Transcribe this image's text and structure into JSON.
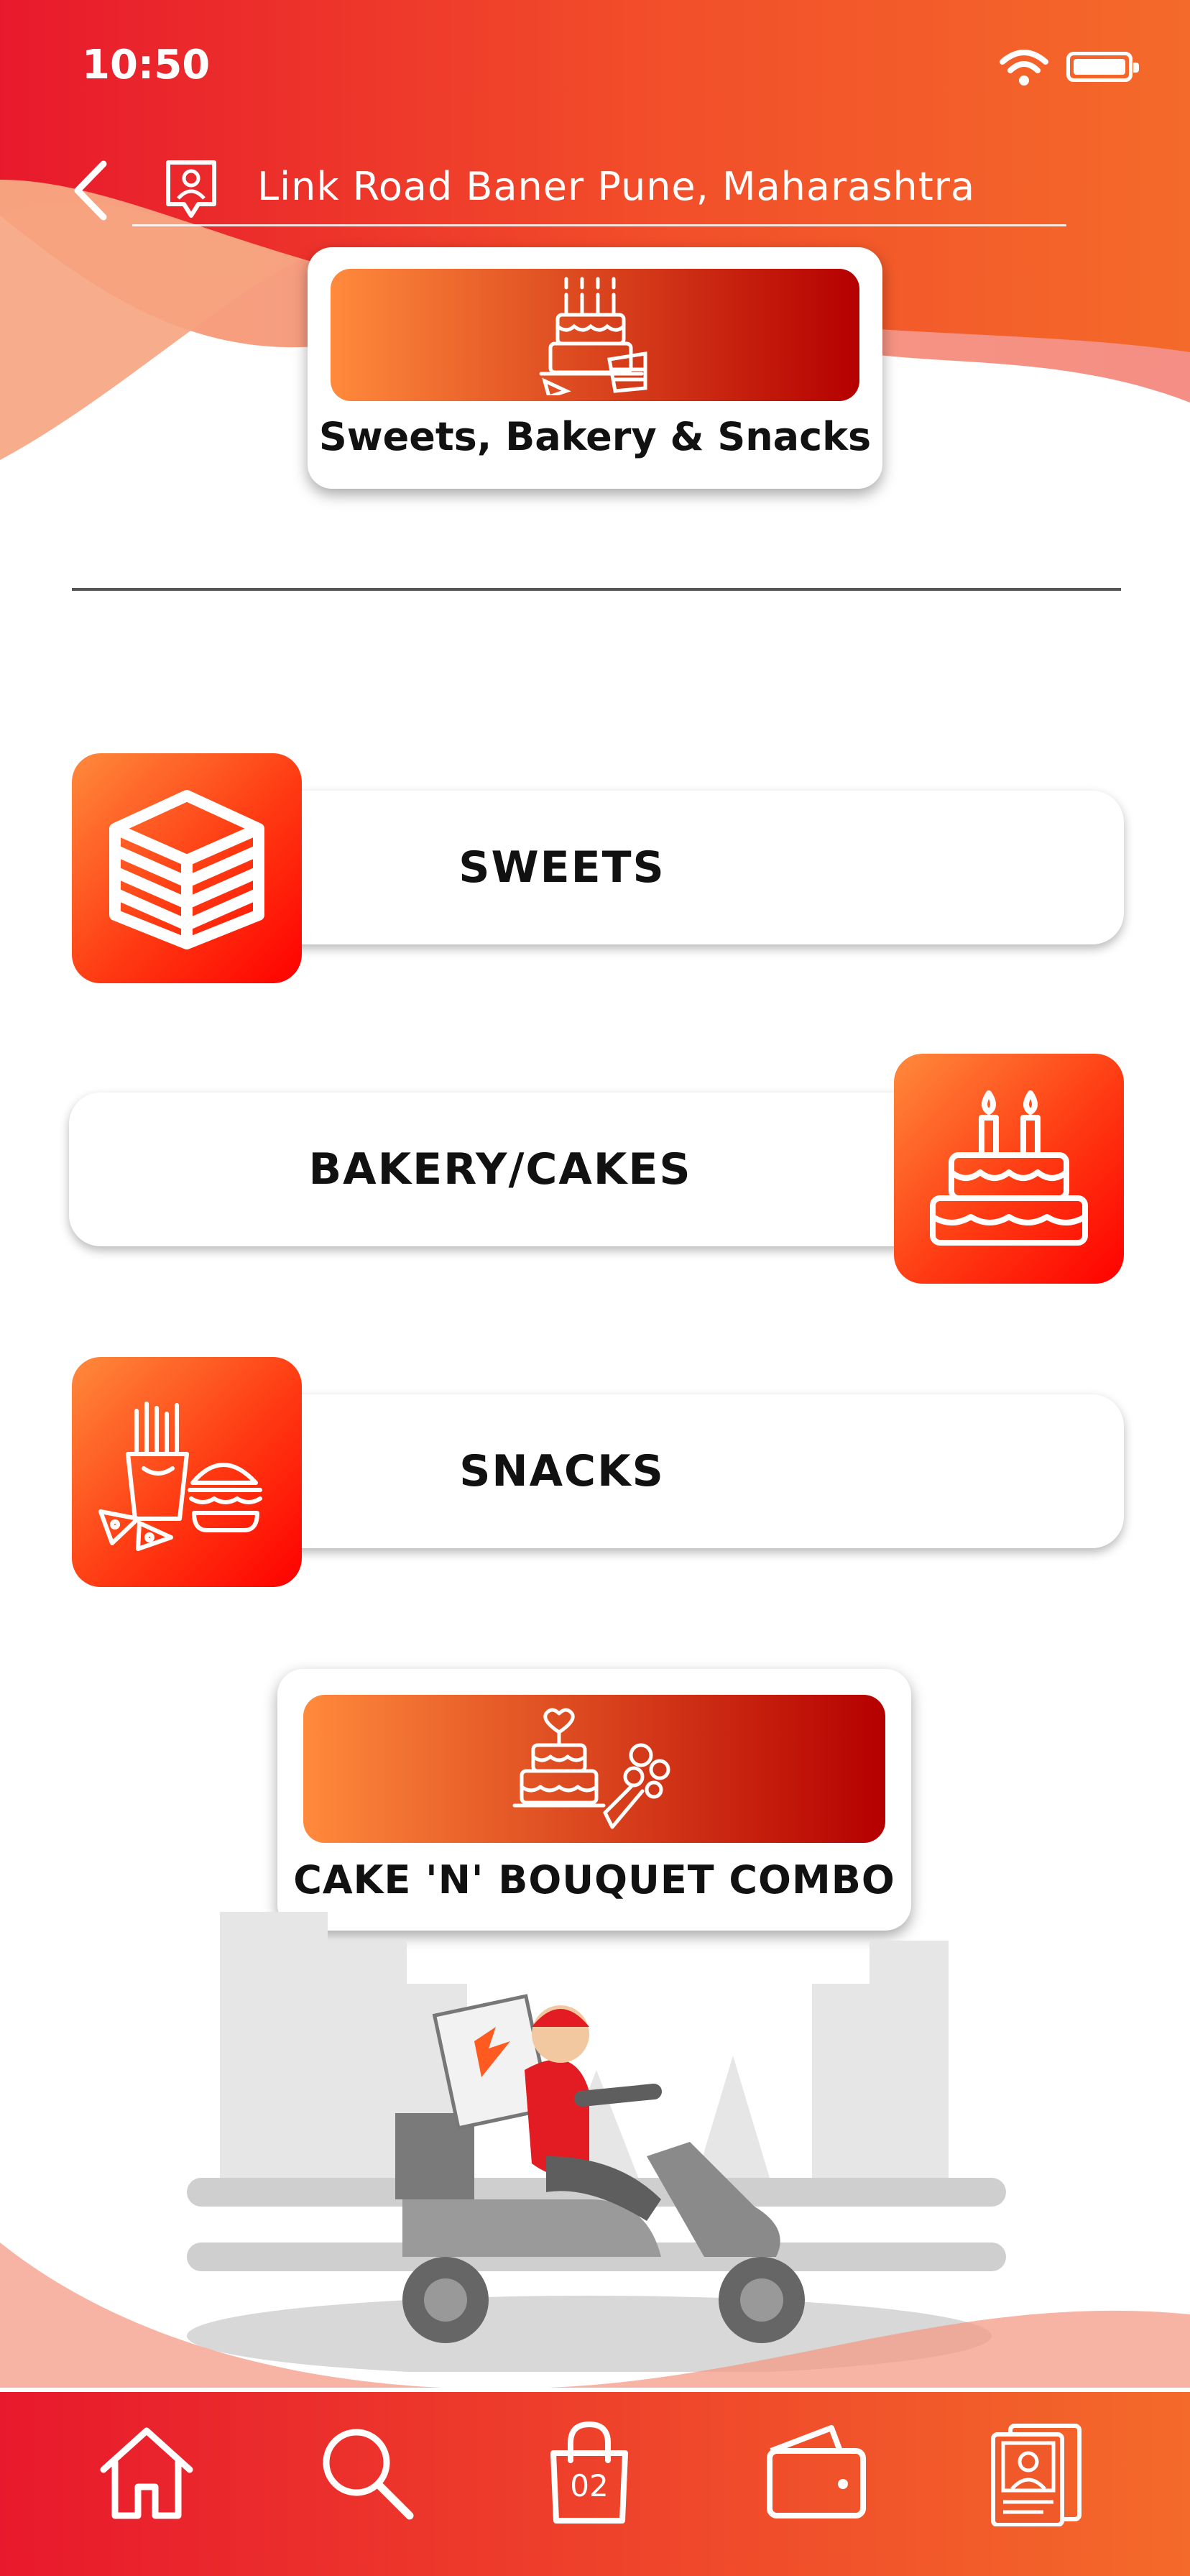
{
  "status_bar": {
    "time": "10:50"
  },
  "header": {
    "location": "Link Road Baner Pune, Maharashtra"
  },
  "category": {
    "title": "Sweets, Bakery & Snacks"
  },
  "menu": {
    "sweets": "SWEETS",
    "bakery": "BAKERY/CAKES",
    "snacks": "SNACKS"
  },
  "combo": {
    "title": "CAKE 'N' BOUQUET COMBO"
  },
  "bottom_nav": {
    "cart_count": "02"
  },
  "colors": {
    "accent": "#ff3a12",
    "accent_dark": "#b50000",
    "accent_light": "#ff8a3c"
  },
  "icons": [
    "back-icon",
    "location-user-icon",
    "cake-icon",
    "sweets-box-icon",
    "birthday-cake-icon",
    "snacks-icon",
    "cake-bouquet-icon",
    "home-icon",
    "search-icon",
    "shopping-bag-icon",
    "wallet-icon",
    "profile-icon"
  ]
}
